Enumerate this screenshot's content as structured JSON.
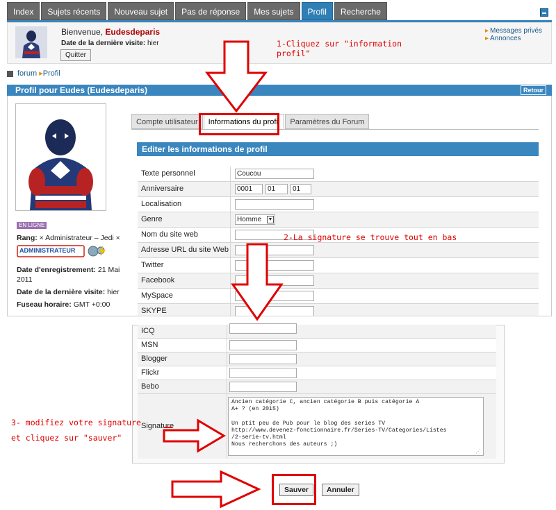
{
  "nav": {
    "tabs": [
      "Index",
      "Sujets récents",
      "Nouveau sujet",
      "Pas de réponse",
      "Mes sujets",
      "Profil",
      "Recherche"
    ],
    "active_index": 5
  },
  "welcome": {
    "greeting": "Bienvenue, ",
    "username": "Eudesdeparis",
    "last_visit_label": "Date de la dernière visite:",
    "last_visit_value": " hier",
    "quit_label": "Quitter",
    "side_links": [
      "Messages privés",
      "Annonces"
    ]
  },
  "breadcrumb": [
    "forum",
    "Profil"
  ],
  "profile": {
    "header": "Profil pour Eudes (Eudesdeparis)",
    "back_label": "Retour",
    "online": "EN LIGNE",
    "rank_label": "Rang:",
    "rank_value": " × Administrateur – Jedi ×",
    "admin_badge": "ADMINISTRATEUR",
    "registration_label": "Date d'enregistrement:",
    "registration_value": " 21 Mai",
    "registration_year": "2011",
    "last_visit_label": "Date de la dernière visite:",
    "last_visit_value": " hier",
    "timezone_label": "Fuseau horaire:",
    "timezone_value": " GMT +0:00"
  },
  "profile_tabs": [
    "Compte utilisateur",
    "Informations du profil",
    "Paramètres du Forum"
  ],
  "profile_tabs_active": 1,
  "edit_header": "Editer les informations de profil",
  "form": {
    "personal_text": {
      "label": "Texte personnel",
      "value": "Coucou"
    },
    "birthday": {
      "label": "Anniversaire",
      "year": "0001",
      "month": "01",
      "day": "01"
    },
    "location": {
      "label": "Localisation"
    },
    "gender": {
      "label": "Genre",
      "value": "Homme"
    },
    "website_name": {
      "label": "Nom du site web"
    },
    "website_url": {
      "label": "Adresse URL du site Web"
    },
    "twitter": {
      "label": "Twitter"
    },
    "facebook": {
      "label": "Facebook"
    },
    "myspace": {
      "label": "MySpace"
    },
    "skype": {
      "label": "SKYPE"
    },
    "icq": {
      "label": "ICQ"
    },
    "msn": {
      "label": "MSN"
    },
    "blogger": {
      "label": "Blogger"
    },
    "flickr": {
      "label": "Flickr"
    },
    "bebo": {
      "label": "Bebo"
    },
    "signature": {
      "label": "Signature",
      "value": "Ancien catégorie C, ancien catégorie B puis catégorie A\nA+ ? (en 2015)\n\nUn ptit peu de Pub pour le blog des series TV\nhttp://www.devenez-fonctionnaire.fr/Series-TV/Categories/Listes\n/2-serie-tv.html\nNous recherchons des auteurs ;)"
    }
  },
  "buttons": {
    "save": "Sauver",
    "cancel": "Annuler"
  },
  "annotations": {
    "step1_line1": "1-Cliquez sur \"information",
    "step1_line2": "profil\"",
    "step2": "2-La signature se trouve tout en bas",
    "step3_line1": "3- modifiez votre signature",
    "step3_line2": "et cliquez sur \"sauver\""
  },
  "colors": {
    "accent": "#3a86be",
    "annotation": "#e00000",
    "username": "#aa0000"
  }
}
